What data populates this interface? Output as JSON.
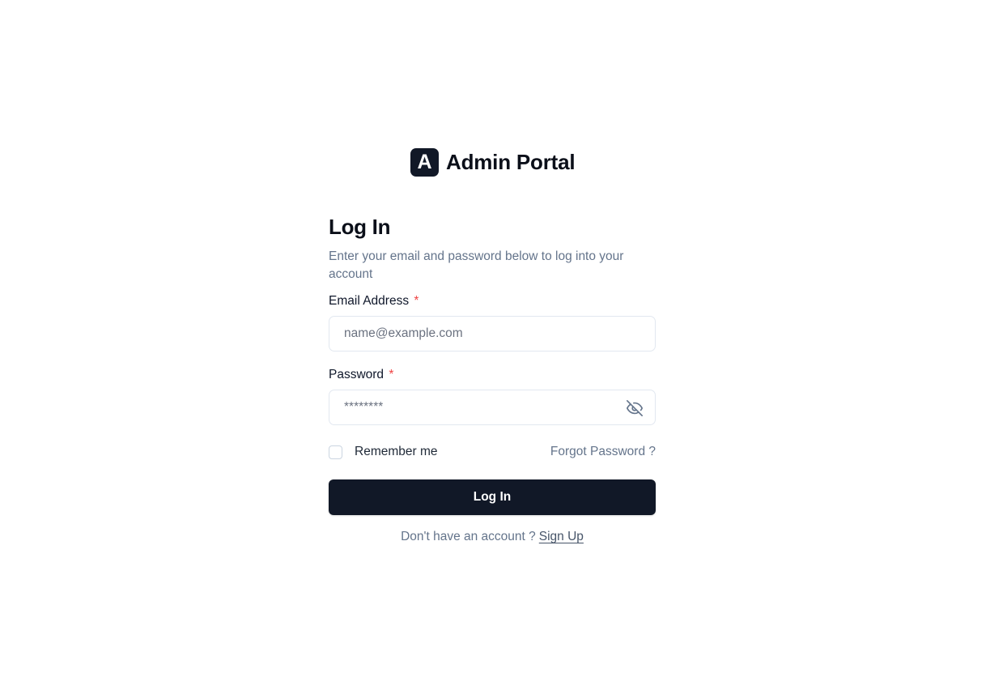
{
  "brand": {
    "logo_letter": "A",
    "name": "Admin Portal"
  },
  "form": {
    "title": "Log In",
    "subtitle": "Enter your email and password below to log into your account",
    "email": {
      "label": "Email Address",
      "required_mark": "*",
      "value": "",
      "placeholder": "name@example.com"
    },
    "password": {
      "label": "Password",
      "required_mark": "*",
      "value": "",
      "placeholder": "********",
      "toggle_icon": "eye-off-icon"
    },
    "remember": {
      "label": "Remember me",
      "checked": false
    },
    "forgot_label": "Forgot Password ?",
    "submit_label": "Log In",
    "signup_prompt": "Don't have an account ?",
    "signup_label": "Sign Up"
  },
  "colors": {
    "primary": "#111827",
    "required": "#ef4444",
    "muted_text": "#64748b",
    "border": "#e2e8f0"
  }
}
